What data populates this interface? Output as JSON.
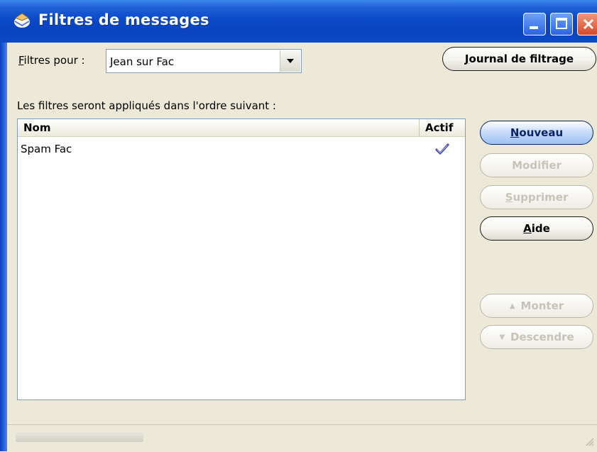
{
  "window": {
    "title": "Filtres de messages",
    "controls": [
      "minimize",
      "maximize",
      "close"
    ]
  },
  "filter_for": {
    "label_mnemonic": "F",
    "label_rest": "iltres pour :",
    "selected_account": "Jean sur Fac"
  },
  "buttons": {
    "journal": {
      "mnemonic": "J",
      "rest": "ournal de filtrage"
    },
    "nouveau": {
      "mnemonic": "N",
      "rest": "ouveau",
      "enabled": true
    },
    "modifier": {
      "label": "Modifier",
      "enabled": false
    },
    "supprimer": {
      "mnemonic": "S",
      "rest": "upprimer",
      "enabled": false
    },
    "aide": {
      "mnemonic": "A",
      "rest": "ide",
      "enabled": true
    },
    "monter": {
      "arrow": "▲",
      "label": "Monter",
      "enabled": false
    },
    "descendre": {
      "arrow": "▼",
      "label": "Descendre",
      "enabled": false
    }
  },
  "order_label": "Les filtres seront appliqués dans l'ordre suivant :",
  "list": {
    "columns": [
      "Nom",
      "Actif"
    ],
    "rows": [
      {
        "name": "Spam Fac",
        "active": true
      }
    ]
  },
  "icons": {
    "app": "thunderbird-icon",
    "active_check": "checkmark-icon"
  },
  "colors": {
    "titlebar": "#0a44bf",
    "window_bg": "#ece9d8",
    "check": "#4a4fa8"
  }
}
